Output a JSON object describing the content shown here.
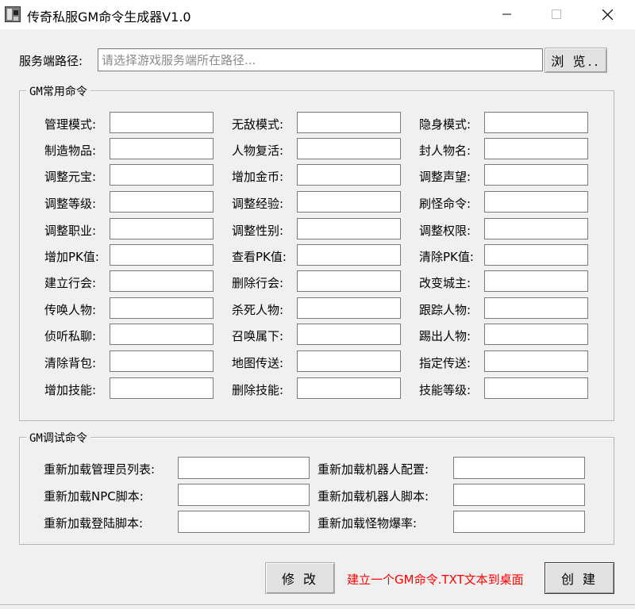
{
  "window": {
    "title": "传奇私服GM命令生成器V1.0",
    "app_icon": "app-icon"
  },
  "server_path": {
    "label": "服务端路径:",
    "value": "",
    "placeholder": "请选择游戏服务端所在路径...",
    "browse_label": "浏 览.."
  },
  "common_group": {
    "title": "GM常用命令",
    "rows": [
      [
        {
          "label": "管理模式:",
          "value": ""
        },
        {
          "label": "无敌模式:",
          "value": ""
        },
        {
          "label": "隐身模式:",
          "value": ""
        }
      ],
      [
        {
          "label": "制造物品:",
          "value": ""
        },
        {
          "label": "人物复活:",
          "value": ""
        },
        {
          "label": "封人物名:",
          "value": ""
        }
      ],
      [
        {
          "label": "调整元宝:",
          "value": ""
        },
        {
          "label": "增加金币:",
          "value": ""
        },
        {
          "label": "调整声望:",
          "value": ""
        }
      ],
      [
        {
          "label": "调整等级:",
          "value": ""
        },
        {
          "label": "调整经验:",
          "value": ""
        },
        {
          "label": "刷怪命令:",
          "value": ""
        }
      ],
      [
        {
          "label": "调整职业:",
          "value": ""
        },
        {
          "label": "调整性别:",
          "value": ""
        },
        {
          "label": "调整权限:",
          "value": ""
        }
      ],
      [
        {
          "label": "增加PK值:",
          "value": ""
        },
        {
          "label": "查看PK值:",
          "value": ""
        },
        {
          "label": "清除PK值:",
          "value": ""
        }
      ],
      [
        {
          "label": "建立行会:",
          "value": ""
        },
        {
          "label": "删除行会:",
          "value": ""
        },
        {
          "label": "改变城主:",
          "value": ""
        }
      ],
      [
        {
          "label": "传唤人物:",
          "value": ""
        },
        {
          "label": "杀死人物:",
          "value": ""
        },
        {
          "label": "跟踪人物:",
          "value": ""
        }
      ],
      [
        {
          "label": "侦听私聊:",
          "value": ""
        },
        {
          "label": "召唤属下:",
          "value": ""
        },
        {
          "label": "踢出人物:",
          "value": ""
        }
      ],
      [
        {
          "label": "清除背包:",
          "value": ""
        },
        {
          "label": "地图传送:",
          "value": ""
        },
        {
          "label": "指定传送:",
          "value": ""
        }
      ],
      [
        {
          "label": "增加技能:",
          "value": ""
        },
        {
          "label": "删除技能:",
          "value": ""
        },
        {
          "label": "技能等级:",
          "value": ""
        }
      ]
    ]
  },
  "debug_group": {
    "title": "GM调试命令",
    "rows": [
      [
        {
          "label": "重新加载管理员列表:",
          "value": ""
        },
        {
          "label": "重新加载机器人配置:",
          "value": ""
        }
      ],
      [
        {
          "label": "重新加载NPC脚本:",
          "value": ""
        },
        {
          "label": "重新加载机器人脚本:",
          "value": ""
        }
      ],
      [
        {
          "label": "重新加载登陆脚本:",
          "value": ""
        },
        {
          "label": "重新加载怪物爆率:",
          "value": ""
        }
      ]
    ]
  },
  "footer": {
    "modify_label": "修 改",
    "hint": "建立一个GM命令.TXT文本到桌面",
    "create_label": "创 建",
    "hint_color": "#ff0000"
  }
}
